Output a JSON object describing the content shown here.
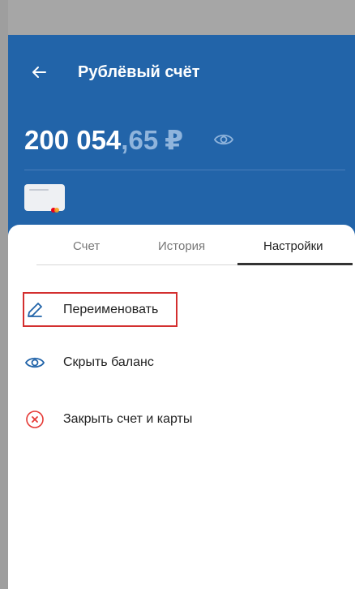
{
  "header": {
    "title": "Рублёвый счёт",
    "balance_main": "200 054",
    "balance_fraction": ",65",
    "currency": "₽",
    "back_icon": "arrow-left-icon",
    "visibility_icon": "eye-icon",
    "bg_color": "#2264a9"
  },
  "tabs": [
    {
      "label": "Счет",
      "active": false
    },
    {
      "label": "История",
      "active": false
    },
    {
      "label": "Настройки",
      "active": true
    }
  ],
  "menu": [
    {
      "label": "Переименовать",
      "icon": "pencil-icon",
      "color": "#2264a9"
    },
    {
      "label": "Скрыть баланс",
      "icon": "eye-icon",
      "color": "#2264a9"
    },
    {
      "label": "Закрыть счет и карты",
      "icon": "close-circle-icon",
      "color": "#e53935"
    }
  ],
  "highlight_color": "#d32f2f"
}
